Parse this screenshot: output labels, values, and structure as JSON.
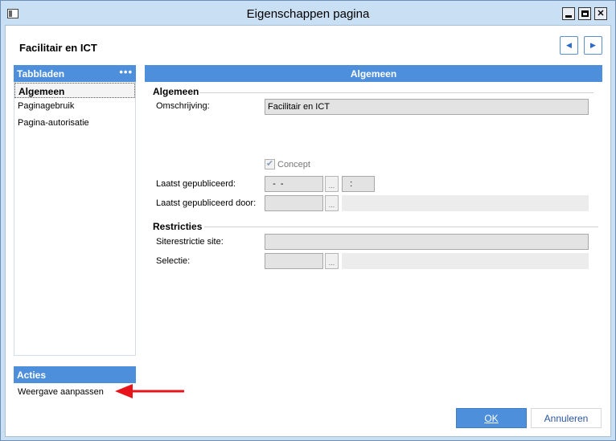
{
  "window": {
    "title": "Eigenschappen pagina"
  },
  "header": {
    "title": "Facilitair en ICT",
    "prev_icon": "chevron-left-icon",
    "next_icon": "chevron-right-icon"
  },
  "tabs_panel": {
    "title": "Tabbladen",
    "more": "•••",
    "items": [
      {
        "label": "Algemeen",
        "active": true
      },
      {
        "label": "Paginagebruik",
        "active": false
      },
      {
        "label": "Pagina-autorisatie",
        "active": false
      }
    ]
  },
  "acties_panel": {
    "title": "Acties",
    "items": [
      {
        "label": "Weergave aanpassen"
      }
    ]
  },
  "main": {
    "title": "Algemeen",
    "section_general": "Algemeen",
    "omschrijving_label": "Omschrijving:",
    "omschrijving_value": "Facilitair en ICT",
    "concept_label": "Concept",
    "concept_checked": true,
    "published_label": "Laatst gepubliceerd:",
    "published_date": "  -  -",
    "published_time": "  :",
    "published_by_label": "Laatst gepubliceerd door:",
    "section_restrictions": "Restricties",
    "site_restriction_label": "Siterestrictie site:",
    "selection_label": "Selectie:",
    "ellipsis": "..."
  },
  "footer": {
    "ok_label": "OK",
    "cancel_label": "Annuleren"
  },
  "colors": {
    "accent": "#4e8fdc",
    "arrow": "#e8141c"
  }
}
